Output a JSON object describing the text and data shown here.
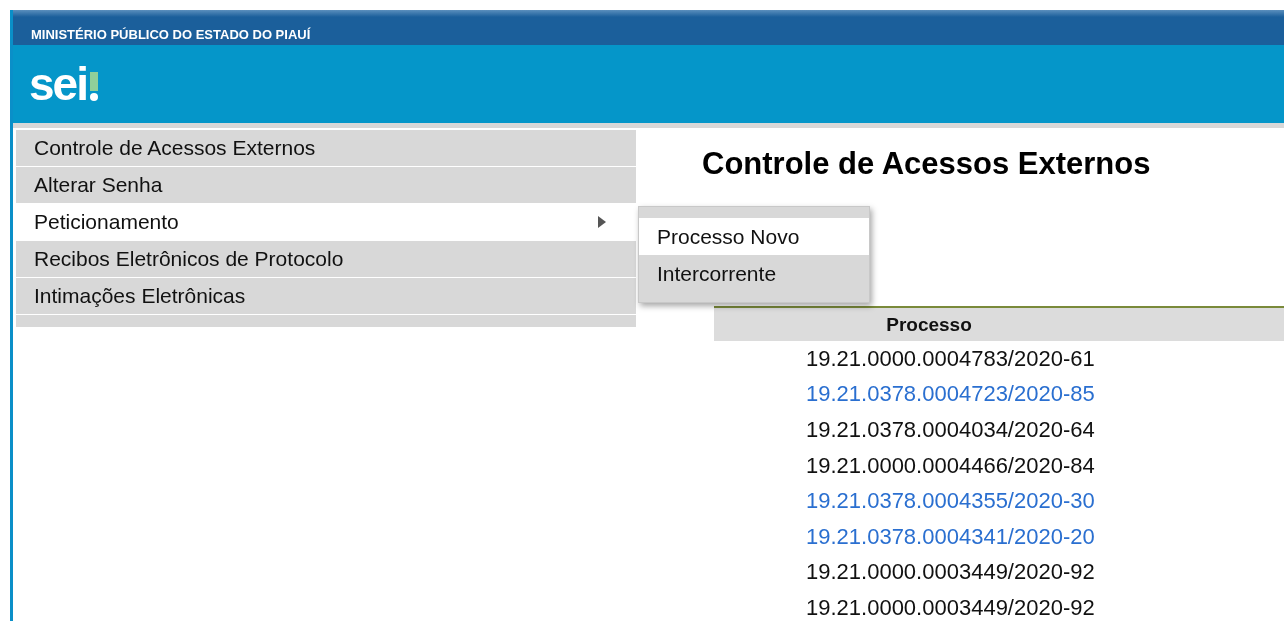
{
  "header": {
    "organization": "MINISTÉRIO PÚBLICO DO ESTADO DO PIAUÍ",
    "logo": "sei"
  },
  "menu": {
    "items": [
      {
        "label": "Controle de Acessos Externos",
        "selected": false,
        "has_submenu": false
      },
      {
        "label": "Alterar Senha",
        "selected": false,
        "has_submenu": false
      },
      {
        "label": "Peticionamento",
        "selected": true,
        "has_submenu": true,
        "submenu": [
          {
            "label": "Processo Novo",
            "selected": true
          },
          {
            "label": "Intercorrente",
            "selected": false
          }
        ]
      },
      {
        "label": "Recibos Eletrônicos de Protocolo",
        "selected": false,
        "has_submenu": false
      },
      {
        "label": "Intimações Eletrônicas",
        "selected": false,
        "has_submenu": false
      }
    ]
  },
  "page_title": "Controle de Acessos Externos",
  "table": {
    "columns": [
      "Processo"
    ],
    "rows": [
      {
        "processo": "19.21.0000.0004783/2020-61",
        "kind": "plain"
      },
      {
        "processo": "19.21.0378.0004723/2020-85",
        "kind": "link"
      },
      {
        "processo": "19.21.0378.0004034/2020-64",
        "kind": "plain"
      },
      {
        "processo": "19.21.0000.0004466/2020-84",
        "kind": "plain"
      },
      {
        "processo": "19.21.0378.0004355/2020-30",
        "kind": "link"
      },
      {
        "processo": "19.21.0378.0004341/2020-20",
        "kind": "link"
      },
      {
        "processo": "19.21.0000.0003449/2020-92",
        "kind": "plain"
      },
      {
        "processo": "19.21.0000.0003449/2020-92",
        "kind": "plain"
      }
    ]
  }
}
